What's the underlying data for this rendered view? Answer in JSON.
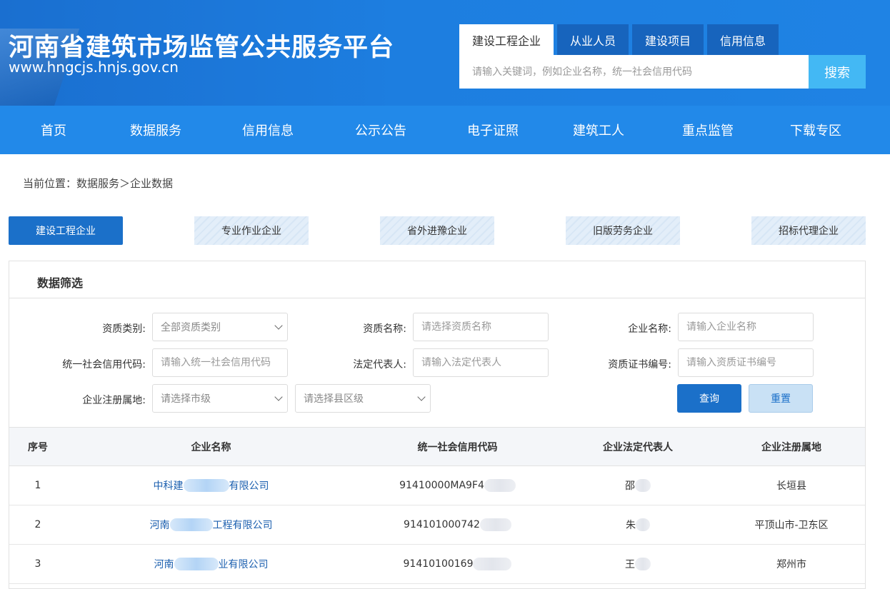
{
  "header": {
    "site_title": "河南省建筑市场监管公共服务平台",
    "site_url": "www.hngcjs.hnjs.gov.cn"
  },
  "search": {
    "tabs": [
      {
        "label": "建设工程企业",
        "active": true
      },
      {
        "label": "从业人员",
        "active": false
      },
      {
        "label": "建设项目",
        "active": false
      },
      {
        "label": "信用信息",
        "active": false
      }
    ],
    "placeholder": "请输入关键词，例如企业名称，统一社会信用代码",
    "button_label": "搜索"
  },
  "nav": {
    "items": [
      "首页",
      "数据服务",
      "信用信息",
      "公示公告",
      "电子证照",
      "建筑工人",
      "重点监管",
      "下载专区"
    ]
  },
  "breadcrumb": "当前位置：数据服务＞企业数据",
  "categories": [
    {
      "label": "建设工程企业",
      "active": true
    },
    {
      "label": "专业作业企业",
      "active": false
    },
    {
      "label": "省外进豫企业",
      "active": false
    },
    {
      "label": "旧版劳务企业",
      "active": false
    },
    {
      "label": "招标代理企业",
      "active": false
    }
  ],
  "filter": {
    "title": "数据筛选",
    "qual_type": {
      "label": "资质类别:",
      "value": "全部资质类别"
    },
    "qual_name": {
      "label": "资质名称:",
      "placeholder": "请选择资质名称"
    },
    "company_name": {
      "label": "企业名称:",
      "placeholder": "请输入企业名称"
    },
    "credit_code": {
      "label": "统一社会信用代码:",
      "placeholder": "请输入统一社会信用代码"
    },
    "legal_rep": {
      "label": "法定代表人:",
      "placeholder": "请输入法定代表人"
    },
    "cert_no": {
      "label": "资质证书编号:",
      "placeholder": "请输入资质证书编号"
    },
    "region": {
      "label": "企业注册属地:",
      "city_value": "请选择市级",
      "county_value": "请选择县区级"
    },
    "query_label": "查询",
    "reset_label": "重置"
  },
  "table": {
    "headers": [
      "序号",
      "企业名称",
      "统一社会信用代码",
      "企业法定代表人",
      "企业注册属地"
    ],
    "rows": [
      {
        "index": "1",
        "name_prefix": "中科建",
        "name_suffix": "有限公司",
        "code_prefix": "91410000MA9F4",
        "rep_prefix": "邵",
        "region": "长垣县"
      },
      {
        "index": "2",
        "name_prefix": "河南",
        "name_suffix": "工程有限公司",
        "code_prefix": "914101000742",
        "rep_prefix": "朱",
        "region": "平顶山市-卫东区"
      },
      {
        "index": "3",
        "name_prefix": "河南",
        "name_suffix": "业有限公司",
        "code_prefix": "91410100169",
        "rep_prefix": "王",
        "region": "郑州市"
      }
    ]
  }
}
